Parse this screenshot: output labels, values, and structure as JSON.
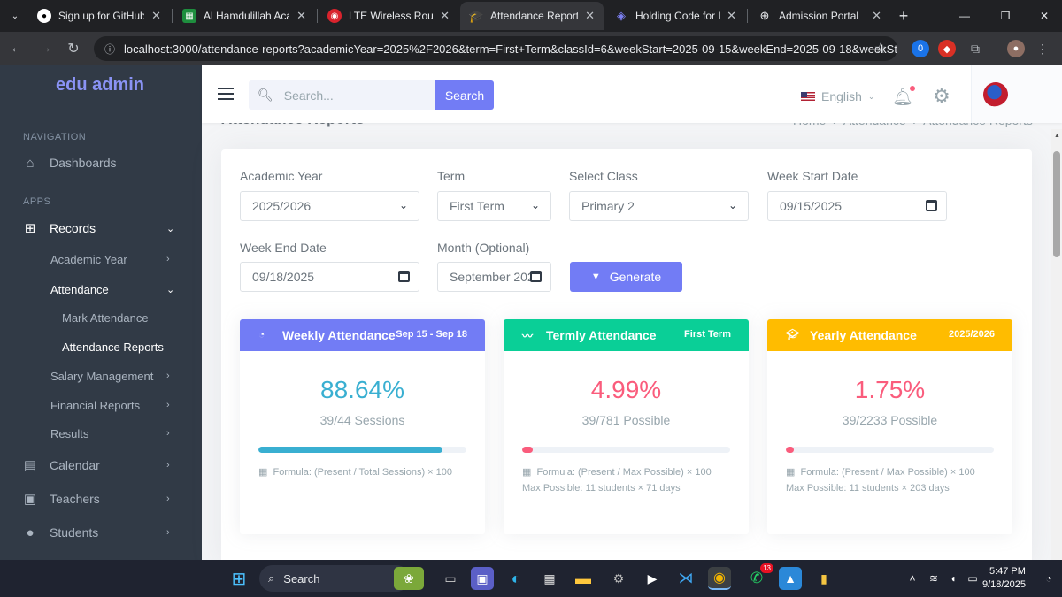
{
  "browser": {
    "tabs": [
      {
        "title": "Sign up for GitHub · G",
        "icon": "github-icon"
      },
      {
        "title": "Al Hamdulillah Acade",
        "icon": "sheets-icon"
      },
      {
        "title": "LTE Wireless Router",
        "icon": "router-icon"
      },
      {
        "title": "Attendance Reports -",
        "icon": "graduation-cap-icon"
      },
      {
        "title": "Holding Code for Fur",
        "icon": "eye-icon"
      },
      {
        "title": "Admission Portal",
        "icon": "globe-icon"
      }
    ],
    "url": "localhost:3000/attendance-reports?academicYear=2025%2F2026&term=First+Term&classId=6&weekStart=2025-09-15&weekEnd=2025-09-18&weekSt...",
    "ext_badge": "0"
  },
  "sidebar": {
    "brand": "edu admin",
    "nav_title": "NAVIGATION",
    "apps_title": "APPS",
    "items": {
      "dashboards": "Dashboards",
      "records": "Records",
      "academic_year": "Academic Year",
      "attendance": "Attendance",
      "mark_attendance": "Mark Attendance",
      "attendance_reports": "Attendance Reports",
      "salary": "Salary Management",
      "financial": "Financial Reports",
      "results": "Results",
      "calendar": "Calendar",
      "teachers": "Teachers",
      "students": "Students"
    }
  },
  "topbar": {
    "search_placeholder": "Search...",
    "search_button": "Search",
    "language": "English"
  },
  "page": {
    "title": "Attendance Reports",
    "breadcrumb": [
      "Home",
      "Attendance",
      "Attendance Reports"
    ]
  },
  "filters": {
    "academic_year_label": "Academic Year",
    "academic_year_value": "2025/2026",
    "term_label": "Term",
    "term_value": "First Term",
    "class_label": "Select Class",
    "class_value": "Primary 2",
    "week_start_label": "Week Start Date",
    "week_start_value": "09/15/2025",
    "week_end_label": "Week End Date",
    "week_end_value": "09/18/2025",
    "month_label": "Month (Optional)",
    "month_value": "September 202",
    "generate_label": "Generate"
  },
  "stats": [
    {
      "title": "Weekly Attendance",
      "badge": "Sep 15 - Sep 18",
      "percent": "88.64%",
      "subtitle": "39/44 Sessions",
      "progress": 0.8864,
      "formula": "Formula: (Present / Total Sessions) × 100",
      "note": "",
      "header_color": "#727cf5",
      "accent": "#39afd1",
      "icon": "pie-chart-icon"
    },
    {
      "title": "Termly Attendance",
      "badge": "First Term",
      "percent": "4.99%",
      "subtitle": "39/781 Possible",
      "progress": 0.0499,
      "formula": "Formula: (Present / Max Possible) × 100",
      "note": "Max Possible: 11 students × 71 days",
      "header_color": "#0acf97",
      "accent": "#fa5c7c",
      "icon": "trend-line-icon"
    },
    {
      "title": "Yearly Attendance",
      "badge": "2025/2026",
      "percent": "1.75%",
      "subtitle": "39/2233 Possible",
      "progress": 0.0175,
      "formula": "Formula: (Present / Max Possible) × 100",
      "note": "Max Possible: 11 students × 203 days",
      "header_color": "#ffbc00",
      "accent": "#fa5c7c",
      "icon": "graduation-cap-icon"
    }
  ],
  "taskbar": {
    "search_label": "Search",
    "whatsapp_badge": "13",
    "time": "5:47 PM",
    "date": "9/18/2025"
  }
}
